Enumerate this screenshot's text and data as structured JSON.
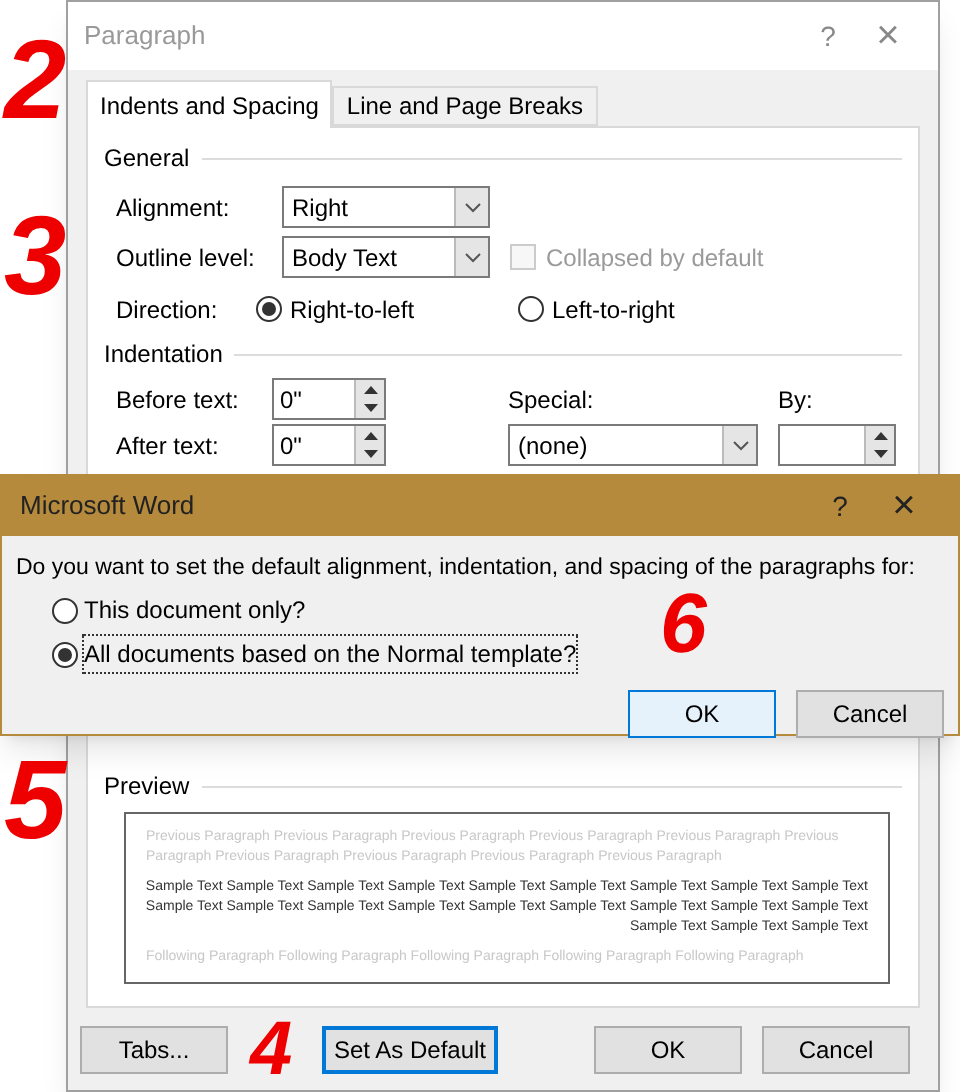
{
  "dialog": {
    "title": "Paragraph",
    "title_buttons": [
      "?",
      "×"
    ],
    "tabs": [
      {
        "label": "Indents and Spacing",
        "selected": true
      },
      {
        "label": "Line and Page Breaks",
        "selected": false
      }
    ],
    "general": {
      "heading": "General",
      "alignment": {
        "label": "Alignment:",
        "value": "Right"
      },
      "outline": {
        "label": "Outline level:",
        "value": "Body Text"
      },
      "collapsed": {
        "label": "Collapsed by default",
        "checked": false,
        "disabled": true
      },
      "direction": {
        "label": "Direction:",
        "options": [
          {
            "label": "Right-to-left",
            "selected": true
          },
          {
            "label": "Left-to-right",
            "selected": false
          }
        ]
      }
    },
    "indentation": {
      "heading": "Indentation",
      "before": {
        "label": "Before text:",
        "value": "0\""
      },
      "after": {
        "label": "After text:",
        "value": "0\""
      },
      "special": {
        "label": "Special:",
        "value": "(none)"
      },
      "by": {
        "label": "By:"
      }
    },
    "preview": {
      "heading": "Preview",
      "previous": [
        "Previous Paragraph Previous Paragraph Previous Paragraph Previous Paragraph Previous Paragraph Previous",
        "Paragraph Previous Paragraph Previous Paragraph Previous Paragraph Previous Paragraph"
      ],
      "sample": [
        "Sample Text Sample Text Sample Text Sample Text Sample Text Sample Text Sample Text Sample Text Sample Text",
        "Sample Text Sample Text Sample Text Sample Text Sample Text Sample Text Sample Text Sample Text Sample Text",
        "Sample Text Sample Text Sample Text"
      ],
      "following": [
        "Following Paragraph Following Paragraph Following Paragraph Following Paragraph Following Paragraph"
      ]
    },
    "buttons": [
      {
        "label": "Tabs...",
        "focused": false
      },
      {
        "label": "Set As Default",
        "focused": true
      },
      {
        "label": "OK",
        "focused": false
      },
      {
        "label": "Cancel",
        "focused": false
      }
    ]
  },
  "message_box": {
    "title": "Microsoft Word",
    "title_buttons": [
      "?",
      "×"
    ],
    "question": "Do you want to set the default alignment, indentation, and spacing of the paragraphs for:",
    "options": [
      {
        "label": "This document only?",
        "selected": false
      },
      {
        "label": "All documents based on the Normal template?",
        "selected": true
      }
    ],
    "buttons": [
      {
        "label": "OK",
        "default": true
      },
      {
        "label": "Cancel",
        "default": false
      }
    ]
  },
  "annotations": [
    "2",
    "3",
    "4",
    "5",
    "6"
  ]
}
